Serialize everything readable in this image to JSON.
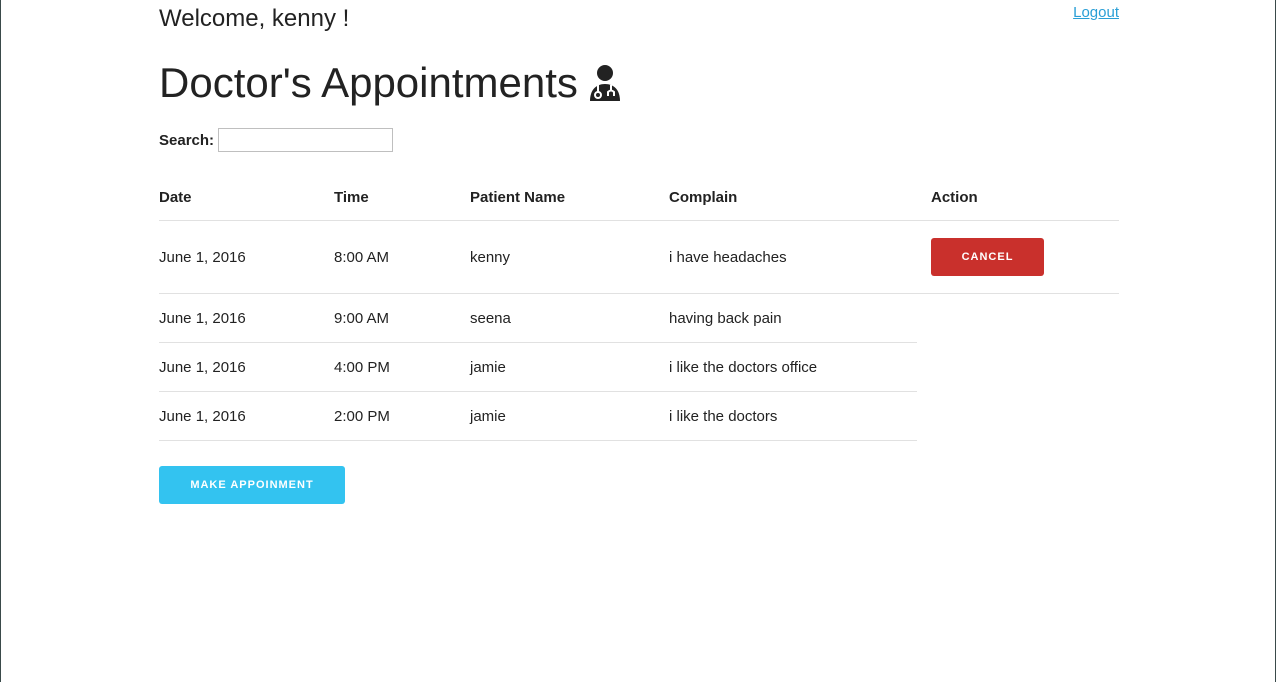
{
  "header": {
    "welcome": "Welcome, kenny !",
    "logout_label": "Logout",
    "title": "Doctor's Appointments",
    "title_icon": "user-doctor-icon"
  },
  "search": {
    "label": "Search:",
    "value": "",
    "placeholder": ""
  },
  "table": {
    "columns": [
      "Date",
      "Time",
      "Patient Name",
      "Complain",
      "Action"
    ],
    "rows": [
      {
        "date": "June 1, 2016",
        "time": "8:00 AM",
        "patient": "kenny",
        "complain": "i have headaches",
        "action": "CANCEL"
      },
      {
        "date": "June 1, 2016",
        "time": "9:00 AM",
        "patient": "seena",
        "complain": "having back pain",
        "action": ""
      },
      {
        "date": "June 1, 2016",
        "time": "4:00 PM",
        "patient": "jamie",
        "complain": "i like the doctors office",
        "action": ""
      },
      {
        "date": "June 1, 2016",
        "time": "2:00 PM",
        "patient": "jamie",
        "complain": "i like the doctors",
        "action": ""
      }
    ]
  },
  "actions": {
    "make_appointment_label": "MAKE APPOINMENT"
  },
  "colors": {
    "cancel_button": "#c9302c",
    "primary_button": "#33c3f0",
    "link": "#2a9fd6"
  }
}
